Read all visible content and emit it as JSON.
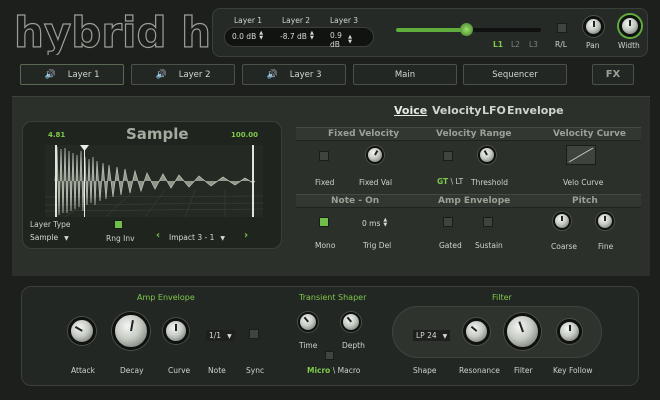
{
  "app": {
    "logo": "hybrid hit"
  },
  "layer_levels": [
    {
      "label": "Layer 1",
      "value": "0.0 dB"
    },
    {
      "label": "Layer 2",
      "value": "-8.7 dB"
    },
    {
      "label": "Layer 3",
      "value": "0.9 dB"
    }
  ],
  "master": {
    "layer_markers": [
      "L1",
      "L2",
      "L3"
    ],
    "rl_label": "R/L",
    "pan_label": "Pan",
    "width_label": "Width"
  },
  "nav": {
    "tabs": [
      "Layer 1",
      "Layer 2",
      "Layer 3",
      "Main",
      "Sequencer"
    ],
    "fx": "FX"
  },
  "subtabs": [
    "Voice",
    "Velocity",
    "LFO",
    "Envelope"
  ],
  "sample": {
    "title": "Sample",
    "start": "4.81",
    "end": "100.00",
    "layer_type_label": "Layer Type",
    "layer_type_value": "Sample",
    "rng_inv_label": "Rng Inv",
    "sample_name": "Impact 3 - 1"
  },
  "fixed_velocity": {
    "title": "Fixed Velocity",
    "fixed_label": "Fixed",
    "fixed_val_label": "Fixed Val"
  },
  "velocity_range": {
    "title": "Velocity Range",
    "gt": "GT",
    "sep": " \\ ",
    "lt": "LT",
    "threshold_label": "Threshold"
  },
  "velocity_curve": {
    "title": "Velocity Curve",
    "label": "Velo Curve"
  },
  "note_on": {
    "title": "Note - On",
    "mono_label": "Mono",
    "trig_del_value": "0 ms",
    "trig_del_label": "Trig Del"
  },
  "amp_env_small": {
    "title": "Amp Envelope",
    "gated_label": "Gated",
    "sustain_label": "Sustain"
  },
  "pitch": {
    "title": "Pitch",
    "coarse_label": "Coarse",
    "fine_label": "Fine"
  },
  "amp_envelope": {
    "title": "Amp Envelope",
    "attack": "Attack",
    "decay": "Decay",
    "curve": "Curve",
    "note_label": "Note",
    "note_value": "1/1",
    "sync": "Sync"
  },
  "transient": {
    "title": "Transient Shaper",
    "time": "Time",
    "depth": "Depth",
    "micro": "Micro",
    "sep": " \\ ",
    "macro": "Macro"
  },
  "filter": {
    "title": "Filter",
    "shape_label": "Shape",
    "shape_value": "LP 24",
    "resonance": "Resonance",
    "filter": "Filter",
    "key_follow": "Key Follow"
  }
}
